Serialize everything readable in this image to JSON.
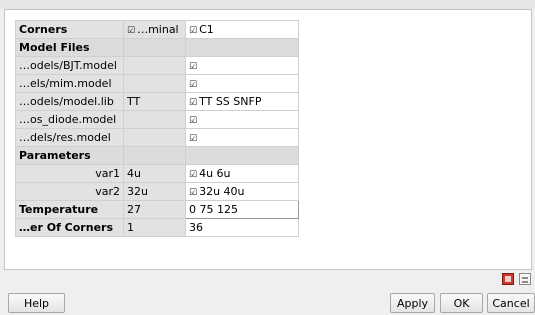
{
  "table": {
    "rows": [
      {
        "c0": "Corners",
        "c1": "…minal",
        "c1_check": true,
        "c2": "C1",
        "c2_check": true
      },
      {
        "c0": "Model Files",
        "c1": "",
        "c2": ""
      },
      {
        "c0": "…odels/BJT.model",
        "c1": "",
        "c2": "",
        "c2_check": true
      },
      {
        "c0": "…els/mim.model",
        "c1": "",
        "c2": "",
        "c2_check": true
      },
      {
        "c0": "…odels/model.lib",
        "c1": "TT",
        "c2": "TT SS SNFP",
        "c2_check": true
      },
      {
        "c0": "…os_diode.model",
        "c1": "",
        "c2": "",
        "c2_check": true
      },
      {
        "c0": "…dels/res.model",
        "c1": "",
        "c2": "",
        "c2_check": true
      },
      {
        "c0": "Parameters",
        "c1": "",
        "c2": ""
      },
      {
        "c0": "var1",
        "c1": "4u",
        "c2": "4u 6u",
        "c2_check": true
      },
      {
        "c0": "var2",
        "c1": "32u",
        "c2": "32u 40u",
        "c2_check": true
      },
      {
        "c0": "Temperature",
        "c1": "27",
        "c2": "0 75 125"
      },
      {
        "c0": "…er Of Corners",
        "c1": "1",
        "c2": "36"
      }
    ]
  },
  "icons": {
    "left": "delete-icon",
    "right": "list-icon"
  },
  "buttons": {
    "help": "Help",
    "apply": "Apply",
    "ok": "OK",
    "cancel": "Cancel"
  }
}
